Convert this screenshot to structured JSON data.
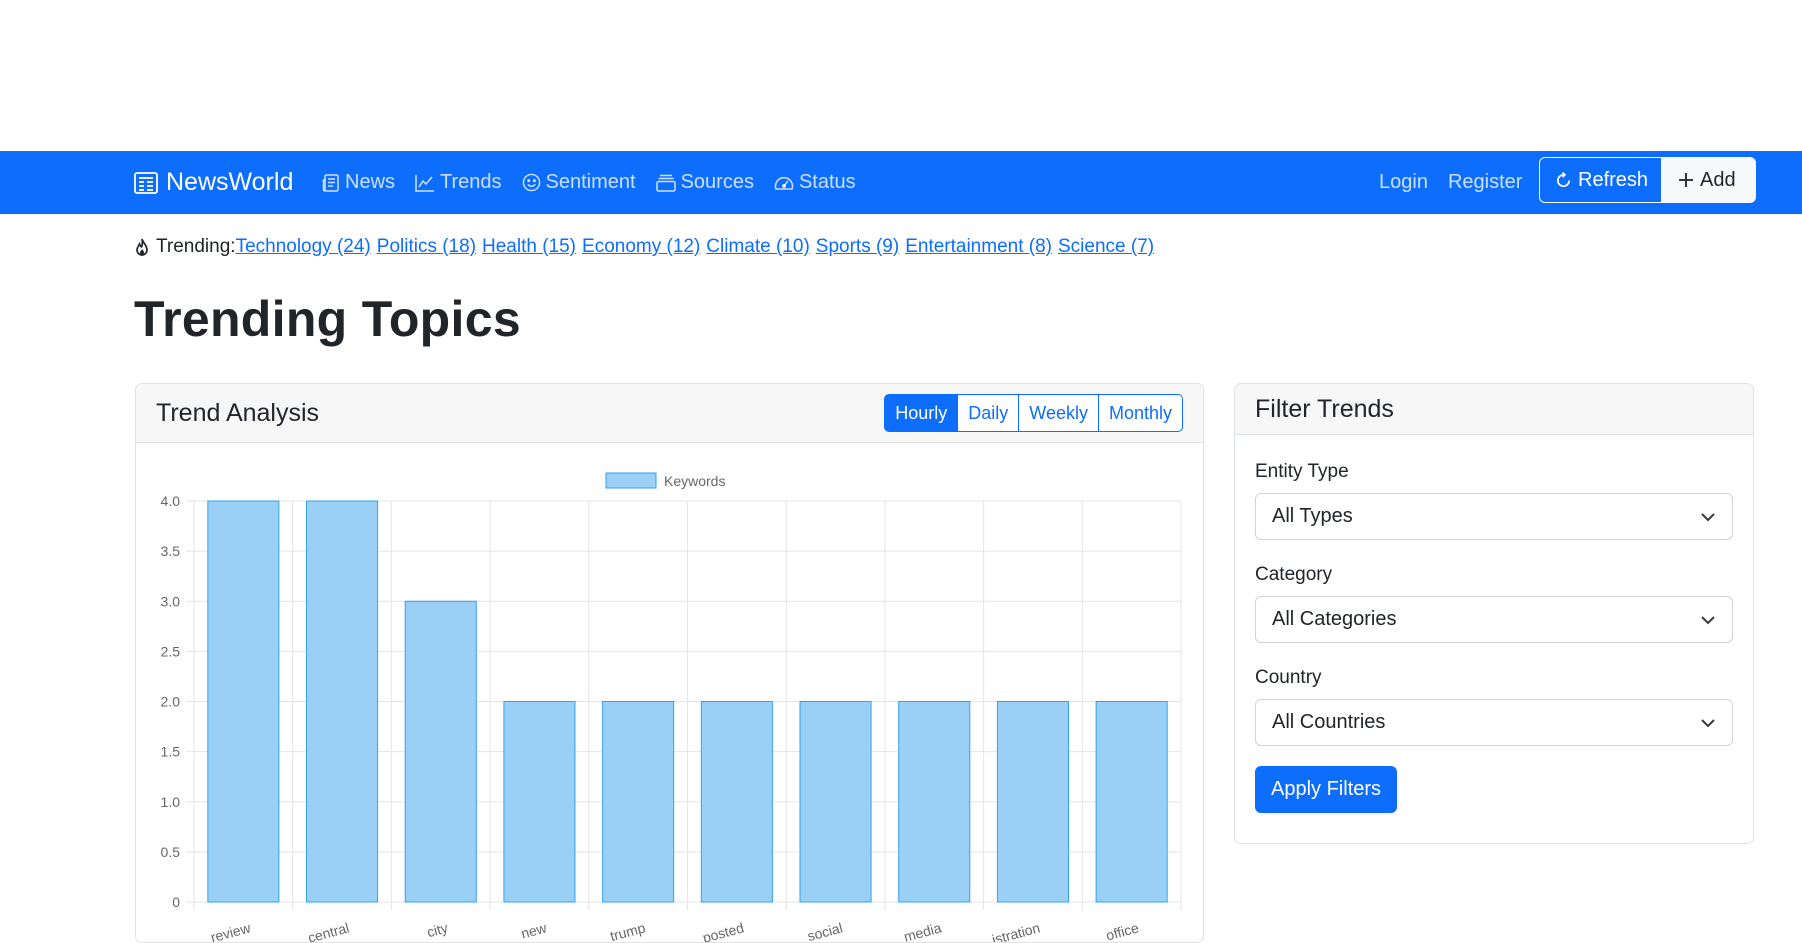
{
  "navbar": {
    "brand": "NewsWorld",
    "links": [
      {
        "label": "News",
        "icon": "newspaper-icon"
      },
      {
        "label": "Trends",
        "icon": "graph-up-icon"
      },
      {
        "label": "Sentiment",
        "icon": "emoji-smile-icon"
      },
      {
        "label": "Sources",
        "icon": "collection-icon"
      },
      {
        "label": "Status",
        "icon": "speedometer-icon"
      }
    ],
    "login": "Login",
    "register": "Register",
    "refresh_label": "Refresh",
    "add_label": "Add"
  },
  "trending": {
    "label": "Trending:",
    "topics": [
      "Technology (24)",
      "Politics (18)",
      "Health (15)",
      "Economy (12)",
      "Climate (10)",
      "Sports (9)",
      "Entertainment (8)",
      "Science (7)"
    ]
  },
  "page": {
    "title": "Trending Topics"
  },
  "trend_card": {
    "title": "Trend Analysis",
    "periods": [
      "Hourly",
      "Daily",
      "Weekly",
      "Monthly"
    ],
    "active_period": "Hourly"
  },
  "filter_card": {
    "title": "Filter Trends",
    "entity_type_label": "Entity Type",
    "entity_type_value": "All Types",
    "category_label": "Category",
    "category_value": "All Categories",
    "country_label": "Country",
    "country_value": "All Countries",
    "apply_label": "Apply Filters"
  },
  "colors": {
    "primary": "#0d6efd",
    "bar_fill": "#9ad0f5",
    "bar_border": "#36a2eb"
  },
  "chart_data": {
    "type": "bar",
    "categories": [
      "review",
      "central",
      "city",
      "new",
      "trump",
      "posted",
      "social",
      "media",
      "…istration",
      "office"
    ],
    "series": [
      {
        "name": "Keywords",
        "values": [
          4,
          4,
          3,
          2,
          2,
          2,
          2,
          2,
          2,
          2
        ]
      }
    ],
    "ylim": [
      0,
      4
    ],
    "yticks": [
      "0",
      "0.5",
      "1.0",
      "1.5",
      "2.0",
      "2.5",
      "3.0",
      "3.5",
      "4.0"
    ],
    "grid": true,
    "legend": "top-center"
  }
}
